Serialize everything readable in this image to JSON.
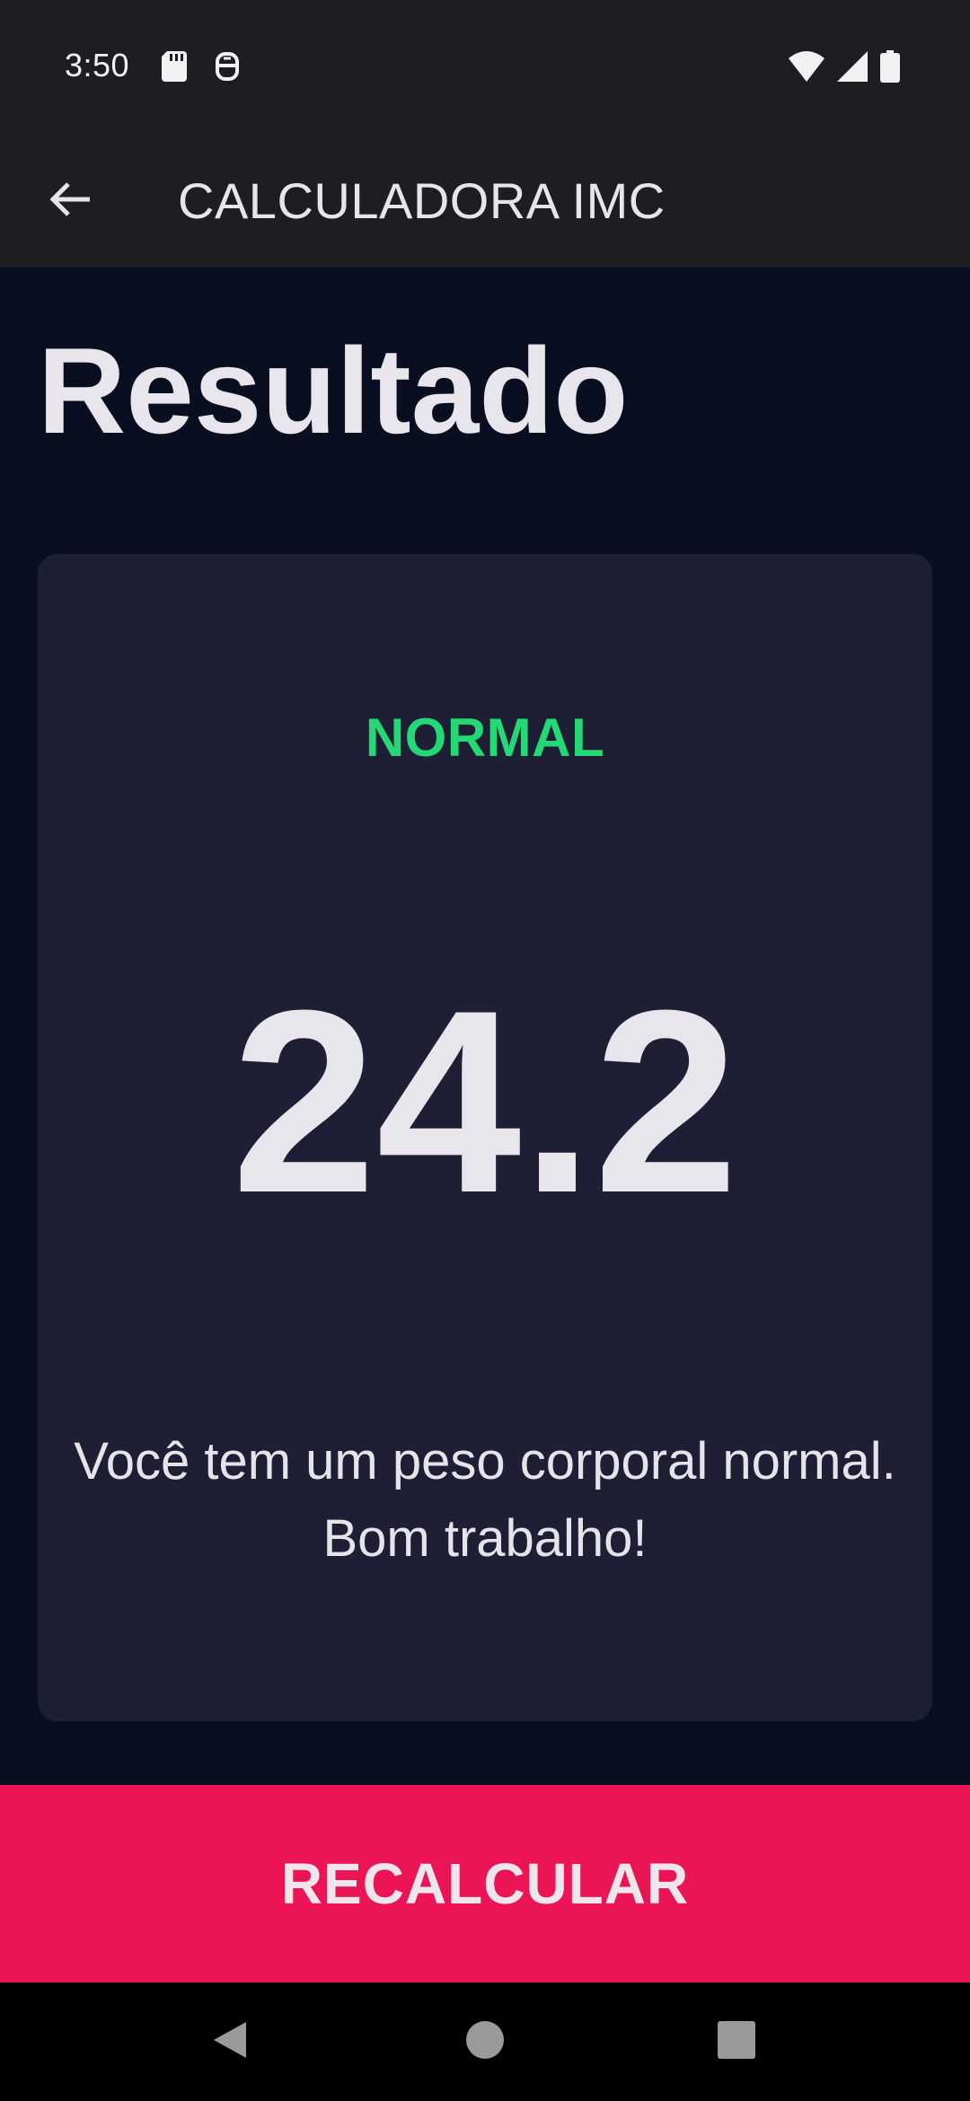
{
  "status_bar": {
    "time": "3:50",
    "left_icons": [
      "sd-card-icon",
      "debug-icon"
    ],
    "right_icons": [
      "wifi-icon",
      "cell-signal-icon",
      "battery-icon"
    ]
  },
  "app_bar": {
    "back_icon": "arrow-left-icon",
    "title": "CALCULADORA IMC"
  },
  "page": {
    "title": "Resultado"
  },
  "result": {
    "status_label": "NORMAL",
    "bmi_value": "24.2",
    "message_line1": "Você tem um peso corporal normal.",
    "message_line2": "Bom trabalho!"
  },
  "actions": {
    "recalculate_label": "RECALCULAR"
  },
  "nav_bar": {
    "buttons": [
      "back-triangle-icon",
      "home-circle-icon",
      "recents-square-icon"
    ]
  },
  "colors": {
    "background": "#0a0e21",
    "card": "#1e1f35",
    "accent": "#eb1555",
    "status_normal": "#24d876",
    "bar": "#1e1d22"
  }
}
